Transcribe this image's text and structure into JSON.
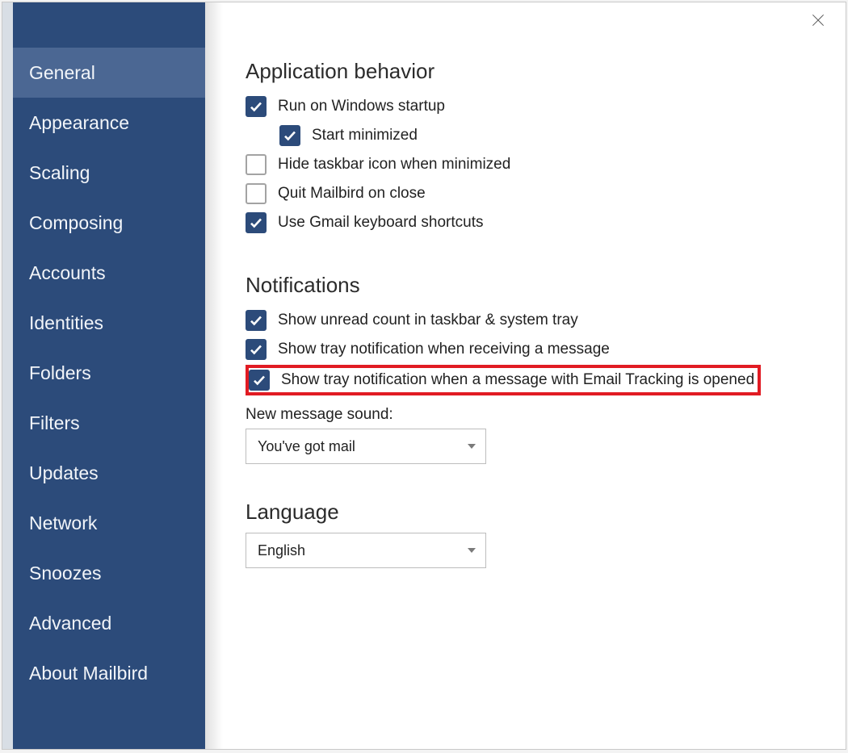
{
  "sidebar": {
    "items": [
      {
        "label": "General",
        "active": true
      },
      {
        "label": "Appearance",
        "active": false
      },
      {
        "label": "Scaling",
        "active": false
      },
      {
        "label": "Composing",
        "active": false
      },
      {
        "label": "Accounts",
        "active": false
      },
      {
        "label": "Identities",
        "active": false
      },
      {
        "label": "Folders",
        "active": false
      },
      {
        "label": "Filters",
        "active": false
      },
      {
        "label": "Updates",
        "active": false
      },
      {
        "label": "Network",
        "active": false
      },
      {
        "label": "Snoozes",
        "active": false
      },
      {
        "label": "Advanced",
        "active": false
      },
      {
        "label": "About Mailbird",
        "active": false
      }
    ]
  },
  "sections": {
    "app_behavior": {
      "title": "Application behavior",
      "options": [
        {
          "label": "Run on Windows startup",
          "checked": true,
          "indent": false
        },
        {
          "label": "Start minimized",
          "checked": true,
          "indent": true
        },
        {
          "label": "Hide taskbar icon when minimized",
          "checked": false,
          "indent": false
        },
        {
          "label": "Quit Mailbird on close",
          "checked": false,
          "indent": false
        },
        {
          "label": "Use Gmail keyboard shortcuts",
          "checked": true,
          "indent": false
        }
      ]
    },
    "notifications": {
      "title": "Notifications",
      "options": [
        {
          "label": "Show unread count in taskbar & system tray",
          "checked": true,
          "highlight": false
        },
        {
          "label": "Show tray notification when receiving a message",
          "checked": true,
          "highlight": false
        },
        {
          "label": "Show tray notification when a message with Email Tracking is opened",
          "checked": true,
          "highlight": true
        }
      ],
      "sound_label": "New message sound:",
      "sound_value": "You've got mail"
    },
    "language": {
      "title": "Language",
      "value": "English"
    }
  }
}
